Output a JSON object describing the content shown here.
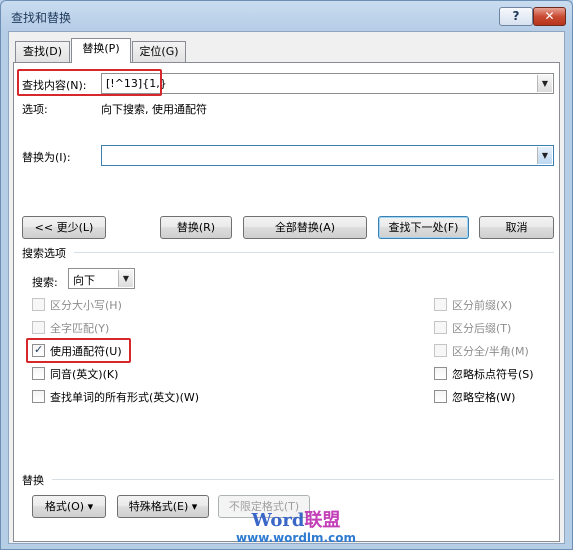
{
  "window": {
    "title": "查找和替换",
    "help_label": "?",
    "close_label": "✕"
  },
  "tabs": [
    {
      "label": "查找(D)",
      "active": false
    },
    {
      "label": "替换(P)",
      "active": true
    },
    {
      "label": "定位(G)",
      "active": false
    }
  ],
  "find": {
    "label": "查找内容(N):",
    "value": "[!^13]{1,}",
    "options_label": "选项:",
    "options_value": "向下搜索, 使用通配符"
  },
  "replace": {
    "label": "替换为(I):",
    "value": ""
  },
  "buttons": {
    "less": "<< 更少(L)",
    "replace": "替换(R)",
    "replace_all": "全部替换(A)",
    "find_next": "查找下一处(F)",
    "cancel": "取消"
  },
  "search_options": {
    "group_title": "搜索选项",
    "search_label": "搜索:",
    "direction": "向下",
    "left_checks": [
      {
        "label": "区分大小写(H)",
        "checked": false,
        "enabled": false
      },
      {
        "label": "全字匹配(Y)",
        "checked": false,
        "enabled": false
      },
      {
        "label": "使用通配符(U)",
        "checked": true,
        "enabled": true
      },
      {
        "label": "同音(英文)(K)",
        "checked": false,
        "enabled": true
      },
      {
        "label": "查找单词的所有形式(英文)(W)",
        "checked": false,
        "enabled": true
      }
    ],
    "right_checks": [
      {
        "label": "区分前缀(X)",
        "checked": false,
        "enabled": false
      },
      {
        "label": "区分后缀(T)",
        "checked": false,
        "enabled": false
      },
      {
        "label": "区分全/半角(M)",
        "checked": false,
        "enabled": false
      },
      {
        "label": "忽略标点符号(S)",
        "checked": false,
        "enabled": true
      },
      {
        "label": "忽略空格(W)",
        "checked": false,
        "enabled": true
      }
    ]
  },
  "replace_section": {
    "group_title": "替换",
    "format_button": "格式(O) ▾",
    "special_button": "特殊格式(E) ▾",
    "no_format_button": "不限定格式(T)"
  },
  "watermark": {
    "brand_latin": "Word",
    "brand_cn": "联盟",
    "url": "www.wordlm.com"
  },
  "colors": {
    "highlight_box": "#d6282a",
    "title_text": "#1e395b"
  }
}
